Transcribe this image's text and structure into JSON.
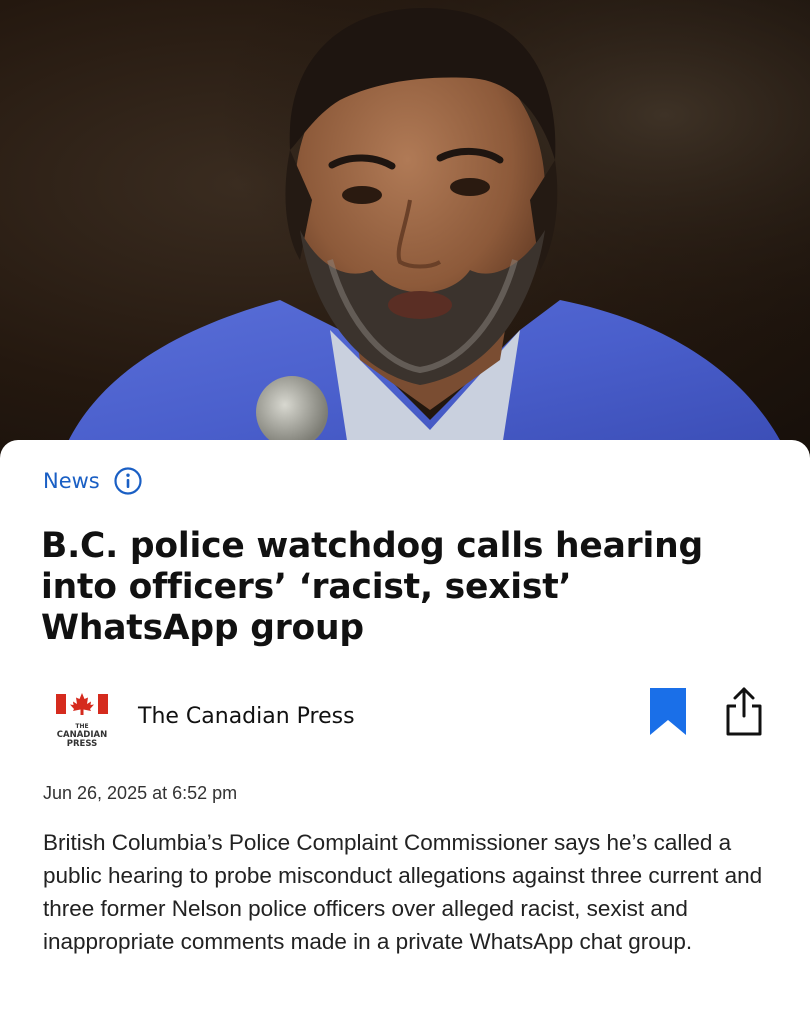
{
  "hero": {
    "image_icon": "portrait-photo"
  },
  "article": {
    "category": "News",
    "info_icon": "info-icon",
    "headline": "B.C. police watchdog calls hearing into officers’ ‘racist, sexist’ WhatsApp group",
    "publisher": {
      "name": "The Canadian Press",
      "logo_the": "THE",
      "logo_canadian": "CANADIAN",
      "logo_press": "PRESS",
      "logo_icon": "maple-leaf-icon"
    },
    "actions": {
      "bookmark_icon": "bookmark-icon",
      "share_icon": "share-icon"
    },
    "timestamp": "Jun 26, 2025 at 6:52 pm",
    "body": "British Columbia’s Police Complaint Commissioner says he’s called a public hearing to probe misconduct allegations against three current and three former Nelson police officers over alleged racist, sexist and inappropriate comments made in a private WhatsApp chat group."
  },
  "colors": {
    "accent": "#1a5fc4",
    "bookmark": "#1a6fe8",
    "logo_red": "#d52b1e"
  }
}
